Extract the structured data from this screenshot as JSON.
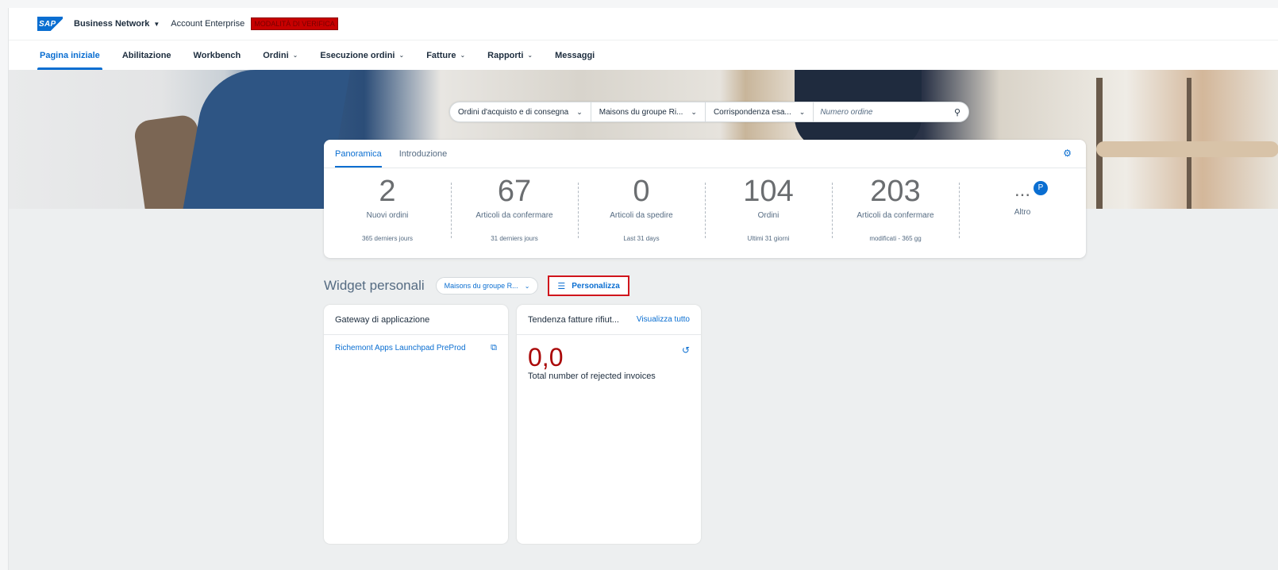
{
  "shell": {
    "logo_text": "SAP",
    "brand": "Business Network",
    "account": "Account Enterprise",
    "mode_badge": "MODALITÀ DI VERIFICA"
  },
  "nav": {
    "items": [
      {
        "label": "Pagina iniziale",
        "active": true,
        "dropdown": false
      },
      {
        "label": "Abilitazione",
        "active": false,
        "dropdown": false
      },
      {
        "label": "Workbench",
        "active": false,
        "dropdown": false
      },
      {
        "label": "Ordini",
        "active": false,
        "dropdown": true
      },
      {
        "label": "Esecuzione ordini",
        "active": false,
        "dropdown": true
      },
      {
        "label": "Fatture",
        "active": false,
        "dropdown": true
      },
      {
        "label": "Rapporti",
        "active": false,
        "dropdown": true
      },
      {
        "label": "Messaggi",
        "active": false,
        "dropdown": false
      }
    ]
  },
  "search": {
    "doc_type": "Ordini d'acquisto e di consegna",
    "customer": "Maisons du groupe Ri...",
    "match": "Corrispondenza esa...",
    "placeholder": "Numero ordine"
  },
  "overview": {
    "tabs": [
      "Panoramica",
      "Introduzione"
    ],
    "active_tab": 0,
    "kpis": [
      {
        "value": "2",
        "label": "Nuovi ordini",
        "sub": "365 derniers jours"
      },
      {
        "value": "67",
        "label": "Articoli da confermare",
        "sub": "31 derniers jours"
      },
      {
        "value": "0",
        "label": "Articoli da spedire",
        "sub": "Last 31 days"
      },
      {
        "value": "104",
        "label": "Ordini",
        "sub": "Ultimi 31 giorni"
      },
      {
        "value": "203",
        "label": "Articoli da confermare",
        "sub": "modificati - 365 gg"
      }
    ],
    "more": {
      "value": "...",
      "label": "Altro",
      "badge": "P"
    }
  },
  "widgets_header": {
    "title": "Widget personali",
    "select": "Maisons du groupe R...",
    "customize": "Personalizza"
  },
  "widget_gateway": {
    "title": "Gateway di applicazione",
    "items": [
      "Richemont Apps Launchpad PreProd"
    ]
  },
  "widget_rejected": {
    "title": "Tendenza fatture rifiut...",
    "link": "Visualizza tutto",
    "value": "0,0",
    "label": "Total number of rejected invoices"
  },
  "colors": {
    "accent": "#0a6ed1",
    "negative": "#aa0808",
    "highlight_border": "#d0151c",
    "badge": "#c70000"
  }
}
